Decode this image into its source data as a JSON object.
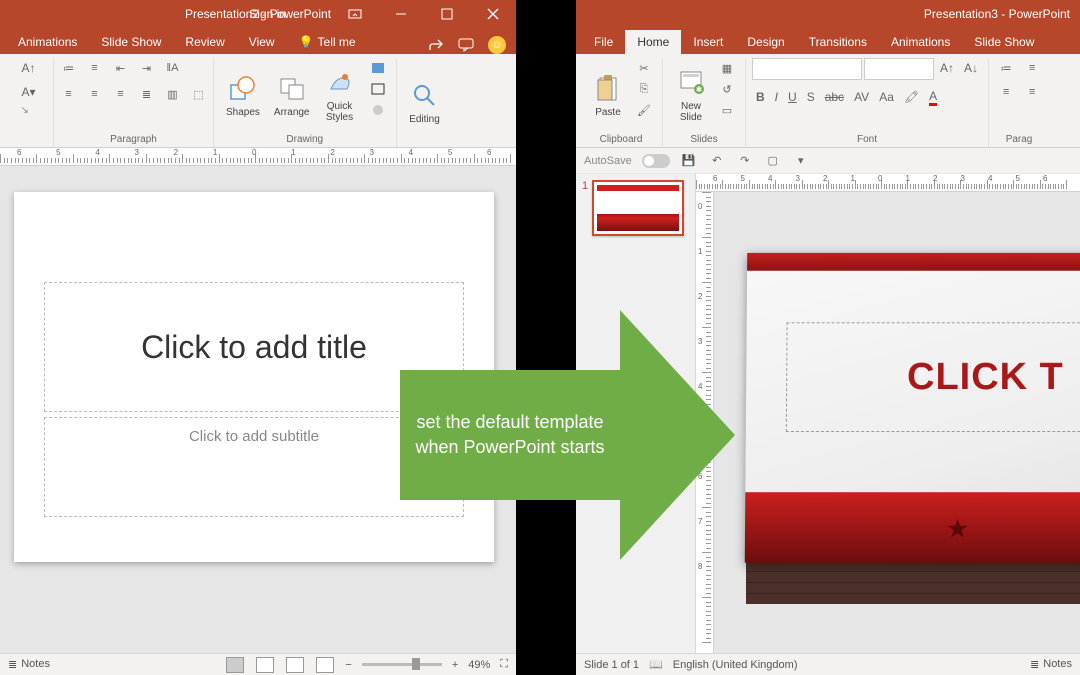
{
  "left": {
    "title": "Presentation2  -  PowerPoint",
    "signin": "Sign in",
    "tabs": [
      "Animations",
      "Slide Show",
      "Review",
      "View"
    ],
    "tellme": "Tell me",
    "groups": {
      "paragraph": "Paragraph",
      "drawing": "Drawing",
      "editing": "Editing"
    },
    "buttons": {
      "shapes": "Shapes",
      "arrange": "Arrange",
      "quick": "Quick\nStyles",
      "editing": "Editing"
    },
    "slide": {
      "title": "Click to add title",
      "subtitle": "Click to add subtitle"
    },
    "status": {
      "notes": "Notes",
      "zoom": "49%"
    }
  },
  "right": {
    "title": "Presentation3  -  PowerPoint",
    "tabs": [
      "File",
      "Home",
      "Insert",
      "Design",
      "Transitions",
      "Animations",
      "Slide Show"
    ],
    "activeTab": "Home",
    "groups": {
      "clipboard": "Clipboard",
      "slides": "Slides",
      "font": "Font",
      "paragraph": "Parag"
    },
    "buttons": {
      "paste": "Paste",
      "newslide": "New\nSlide"
    },
    "autosave": "AutoSave",
    "slideTitle": "CLICK T",
    "thumbNum": "1",
    "status": {
      "slide": "Slide 1 of 1",
      "lang": "English (United Kingdom)",
      "notes": "Notes"
    }
  },
  "arrow": {
    "line1": "set the default template",
    "line2": "when PowerPoint starts"
  },
  "rulerNums": [
    "6",
    "5",
    "4",
    "3",
    "2",
    "1",
    "0",
    "1",
    "2",
    "3",
    "4",
    "5",
    "6"
  ]
}
